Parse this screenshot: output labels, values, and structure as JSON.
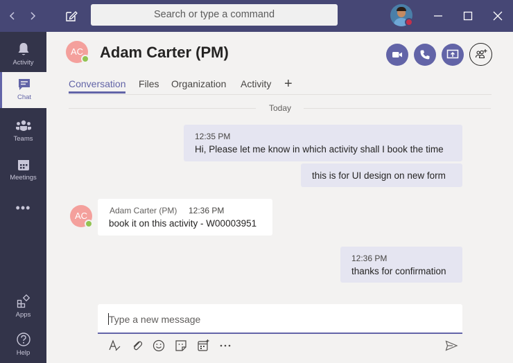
{
  "titlebar": {
    "search_placeholder": "Search or type a command",
    "back_icon": "chevron-left-icon",
    "forward_icon": "chevron-right-icon",
    "compose_icon": "new-chat-icon",
    "user_status_color": "#c4314b",
    "window_controls": [
      "minimize",
      "maximize",
      "close"
    ]
  },
  "rail": {
    "items": [
      {
        "label": "Activity",
        "icon": "bell-icon",
        "active": false
      },
      {
        "label": "Chat",
        "icon": "chat-icon",
        "active": true
      },
      {
        "label": "Teams",
        "icon": "teams-icon",
        "active": false
      },
      {
        "label": "Meetings",
        "icon": "calendar-icon",
        "active": false
      },
      {
        "label": "Apps",
        "icon": "apps-icon",
        "active": false
      },
      {
        "label": "Help",
        "icon": "help-icon",
        "active": false
      }
    ],
    "more": "•••"
  },
  "header": {
    "avatar_initials": "AC",
    "name": "Adam Carter (PM)",
    "presence_color": "#92c353",
    "actions": [
      "video-call",
      "audio-call",
      "share-screen",
      "add-people"
    ]
  },
  "tabs": [
    {
      "label": "Conversation",
      "active": true
    },
    {
      "label": "Files",
      "active": false
    },
    {
      "label": "Organization",
      "active": false
    },
    {
      "label": "Activity",
      "active": false
    }
  ],
  "tab_add": "+",
  "conversation": {
    "date_divider": "Today",
    "messages": [
      {
        "from": "me",
        "time": "12:35 PM",
        "text": "Hi, Please let me know in which activity shall I book the time"
      },
      {
        "from": "me",
        "time": "",
        "text": "this is for UI design on new form"
      },
      {
        "from": "them",
        "author": "Adam Carter (PM)",
        "time": "12:36 PM",
        "avatar_initials": "AC",
        "text": "book it on this activity - W00003951"
      },
      {
        "from": "me",
        "time": "12:36 PM",
        "text": "thanks for confirmation"
      }
    ]
  },
  "compose": {
    "placeholder": "Type a new message",
    "tools": [
      "format-icon",
      "attach-icon",
      "emoji-icon",
      "sticker-icon",
      "schedule-meeting-icon",
      "more-icon",
      "send-icon"
    ]
  },
  "colors": {
    "accent": "#6264a7",
    "titlebar": "#464775",
    "rail": "#33344a",
    "my_bubble": "#e5e5f1",
    "their_bubble": "#ffffff"
  }
}
